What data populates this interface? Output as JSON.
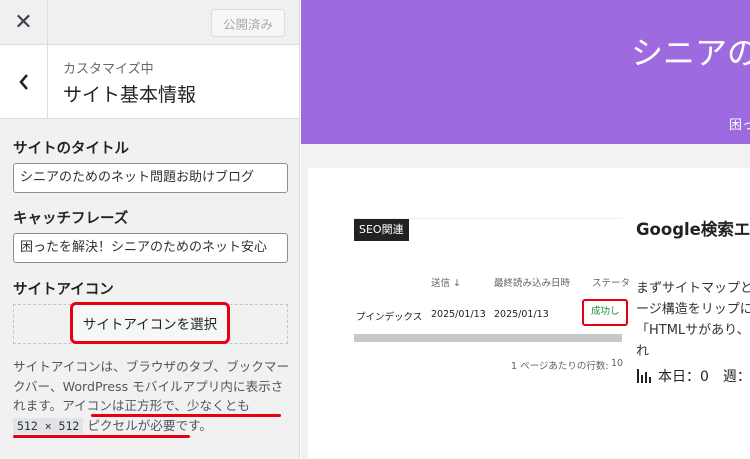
{
  "header": {
    "publish_label": "公開済み"
  },
  "section": {
    "breadcrumb": "カスタマイズ中",
    "title": "サイト基本情報"
  },
  "fields": {
    "site_title_label": "サイトのタイトル",
    "site_title_value": "シニアのためのネット問題お助けブログ",
    "tagline_label": "キャッチフレーズ",
    "tagline_value": "困ったを解決！シニアのためのネット安心",
    "site_icon_label": "サイトアイコン",
    "select_icon_button": "サイトアイコンを選択"
  },
  "description": {
    "part1": "サイトアイコンは、ブラウザのタブ、ブックマークバー、WordPress モバイルアプリ内に表示されます。",
    "part2": "アイコンは正方形で、少なくとも",
    "code": "512 × 512",
    "part3": "ピクセルが必要です。"
  },
  "preview": {
    "site_title": "シニアのた",
    "tagline": "困っ",
    "post": {
      "category": "SEO関連",
      "title": "Google検索エ方法",
      "excerpt": "まずサイトマップと体のページ構造をリップには「HTMLサがあり、それぞれ",
      "stats": "本日：0　週：",
      "screenshot": {
        "col_sent": "送信 ↓",
        "col_last_read": "最終読み込み日時",
        "col_status": "ステータ",
        "row_name": "プインデックス",
        "row_date1": "2025/01/13",
        "row_date2": "2025/01/13",
        "row_status": "成功しま",
        "footer": "1 ページあたりの行数:",
        "footer_value": "10"
      }
    }
  },
  "colors": {
    "accent_red": "#e60012",
    "hero_purple": "#9d6ae0"
  }
}
